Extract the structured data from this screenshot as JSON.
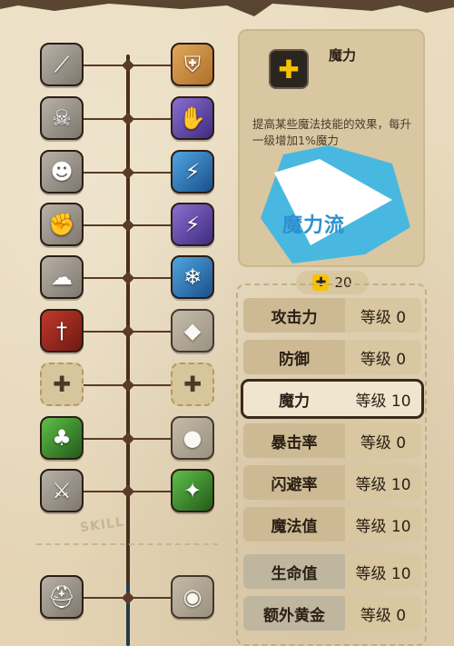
{
  "skills": {
    "left": [
      {
        "icon": "claw-icon",
        "style": "grey"
      },
      {
        "icon": "skull-icon",
        "style": "grey"
      },
      {
        "icon": "shout-icon",
        "style": "grey"
      },
      {
        "icon": "fist-icon",
        "style": "grey"
      },
      {
        "icon": "ghost-icon",
        "style": "grey"
      },
      {
        "icon": "dagger-icon",
        "style": "red"
      },
      {
        "icon": "plus-icon",
        "style": "locked"
      },
      {
        "icon": "treant-icon",
        "style": "green"
      },
      {
        "icon": "cross-sword-icon",
        "style": "grey"
      }
    ],
    "right": [
      {
        "icon": "shield-icon",
        "style": "gold"
      },
      {
        "icon": "dark-hand-icon",
        "style": "purple"
      },
      {
        "icon": "lightning-icon",
        "style": "blue"
      },
      {
        "icon": "shock-icon",
        "style": "purple"
      },
      {
        "icon": "frost-icon",
        "style": "blue"
      },
      {
        "icon": "shard-icon",
        "style": "dim"
      },
      {
        "icon": "plus-icon",
        "style": "locked"
      },
      {
        "icon": "orb-icon",
        "style": "dim"
      },
      {
        "icon": "spirit-icon",
        "style": "green"
      }
    ],
    "lower_left": [
      {
        "icon": "helm-icon",
        "style": "grey"
      }
    ],
    "lower_right": [
      {
        "icon": "eye-icon",
        "style": "dim"
      }
    ],
    "section_label": "SKILL"
  },
  "detail": {
    "icon": "plus-icon",
    "title": "魔力",
    "description": "提高某些魔法技能的效果，每升一级增加1%魔力",
    "banner": "魔力流",
    "banner_color": "#38b6e8"
  },
  "points": {
    "value": "20"
  },
  "stats": [
    {
      "name": "攻击力",
      "level": "等级 0"
    },
    {
      "name": "防御",
      "level": "等级 0"
    },
    {
      "name": "魔力",
      "level": "等级 10",
      "active": true
    },
    {
      "name": "暴击率",
      "level": "等级 0"
    },
    {
      "name": "闪避率",
      "level": "等级 10"
    },
    {
      "name": "魔法值",
      "level": "等级 10"
    },
    {
      "name": "生命值",
      "level": "等级 10",
      "section": "lower"
    },
    {
      "name": "额外黄金",
      "level": "等级 0",
      "section": "lower"
    }
  ]
}
